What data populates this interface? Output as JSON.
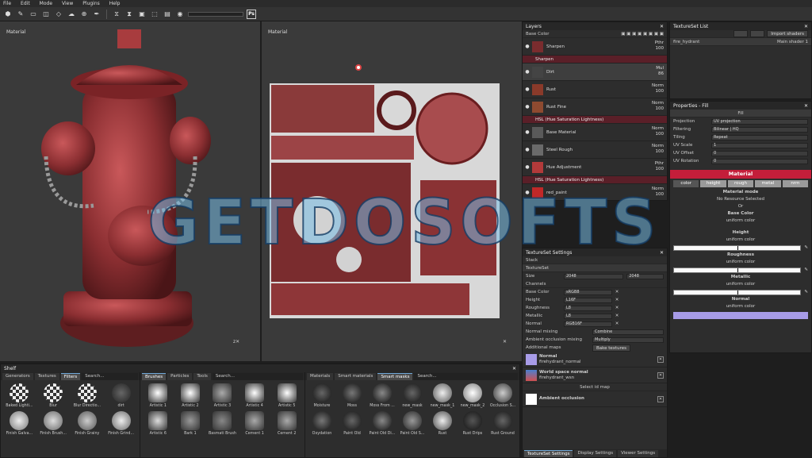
{
  "menu": [
    "File",
    "Edit",
    "Mode",
    "View",
    "Plugins",
    "Help"
  ],
  "toolbar": {
    "ps_label": "Ps"
  },
  "viewport3d": {
    "label": "Material"
  },
  "viewport2d": {
    "label": "Material"
  },
  "layers": {
    "title": "Layers",
    "channel": "Base Color",
    "rows": [
      {
        "name": "Sharpen",
        "blend": "Pthr",
        "opacity": "100",
        "effect": "Sharpen"
      },
      {
        "name": "Dirt",
        "blend": "Mul",
        "opacity": "86"
      },
      {
        "name": "Rust",
        "blend": "Norm",
        "opacity": "100"
      },
      {
        "name": "Rust Fine",
        "blend": "Norm",
        "opacity": "100",
        "effect": "HSL (Hue Saturation Lightness)"
      },
      {
        "name": "Base Material",
        "blend": "Norm",
        "opacity": "100"
      },
      {
        "name": "Steel Rough",
        "blend": "Norm",
        "opacity": "100"
      },
      {
        "name": "Hue Adjustment",
        "blend": "Pthr",
        "opacity": "100",
        "effect": "HSL (Hue Saturation Lightness)"
      },
      {
        "name": "red_paint",
        "blend": "Norm",
        "opacity": "100"
      }
    ]
  },
  "texset_list": {
    "title": "TextureSet List",
    "import_btn": "Import shaders",
    "item": "fire_hydrant",
    "shader": "Main shader 1"
  },
  "properties": {
    "title": "Properties - Fill",
    "fill_label": "Fill",
    "projection_k": "Projection",
    "projection_v": "UV projection",
    "filtering_k": "Filtering",
    "filtering_v": "Bilinear | HQ",
    "tiling_k": "Tiling",
    "tiling_v": "Repeat",
    "uvscale_k": "UV Scale",
    "uvscale_v": "1",
    "uvoffset_k": "UV Offset",
    "uvoffset_v": "0",
    "uvrot_k": "UV Rotation",
    "uvrot_v": "0",
    "material_title": "Material",
    "chips": [
      "color",
      "height",
      "rough",
      "metal",
      "nrm"
    ],
    "material_mode": "Material mode",
    "no_resource": "No Resource Selected",
    "or_label": "Or",
    "base_color": "Base Color",
    "base_color_sub": "uniform color",
    "height": "Height",
    "height_sub": "uniform color",
    "roughness": "Roughness",
    "roughness_sub": "uniform color",
    "metallic": "Metallic",
    "metallic_sub": "uniform color",
    "normal": "Normal",
    "normal_sub": "uniform color"
  },
  "tsettings": {
    "title": "TextureSet Settings",
    "stack": "Stack",
    "textureset": "TextureSet",
    "size_k": "Size",
    "size_v": "2048",
    "size_v2": "2048",
    "channels": "Channels",
    "ch": [
      {
        "k": "Base Color",
        "v": "sRGB8"
      },
      {
        "k": "Height",
        "v": "L16F"
      },
      {
        "k": "Roughness",
        "v": "L8"
      },
      {
        "k": "Metallic",
        "v": "L8"
      },
      {
        "k": "Normal",
        "v": "RGB16F"
      }
    ],
    "normal_mixing_k": "Normal mixing",
    "normal_mixing_v": "Combine",
    "ao_mixing_k": "Ambient occlusion mixing",
    "ao_mixing_v": "Multiply",
    "additional": "Additional maps",
    "bake": "Bake textures",
    "maps": [
      {
        "title": "Normal",
        "file": "firehydrant_normal"
      },
      {
        "title": "World space normal",
        "file": "firehydrant_wsn"
      }
    ],
    "select_map": "Select id map",
    "ao": "Ambient occlusion",
    "bottom_tabs": [
      "TextureSet Settings",
      "Display Settings",
      "Viewer Settings"
    ]
  },
  "shelf": {
    "title": "Shelf",
    "left_tabs": [
      "Generators",
      "Textures",
      "Filters"
    ],
    "left_items": [
      "Baked Lighti...",
      "Blur",
      "Blur Directio...",
      "dirt",
      "Finish Galva...",
      "Finish Brush...",
      "Finish Grainy",
      "Finish Grind..."
    ],
    "mid_tabs": [
      "Brushes",
      "Particles",
      "Tools"
    ],
    "mid_items": [
      "Artistic 1",
      "Artistic 2",
      "Artistic 3",
      "Artistic 4",
      "Artistic 5",
      "Artistic 6",
      "Bark 1",
      "Basmati Brush",
      "Cement 1",
      "Cement 2"
    ],
    "right_tabs": [
      "Materials",
      "Smart materials",
      "Smart masks"
    ],
    "right_items": [
      "Moisture",
      "Moss",
      "Moss From ...",
      "new_mask",
      "new_mask_1",
      "new_mask_2",
      "Occlusion S...",
      "Oxydation",
      "Paint Old",
      "Paint Old Di...",
      "Paint Old S...",
      "Rust",
      "Rust Drips",
      "Rust Ground"
    ],
    "search": "Search..."
  },
  "watermark": "GETDOSOFTS",
  "colors": {
    "accent": "#c41e3a",
    "map_swatch": "#a89ce8"
  }
}
